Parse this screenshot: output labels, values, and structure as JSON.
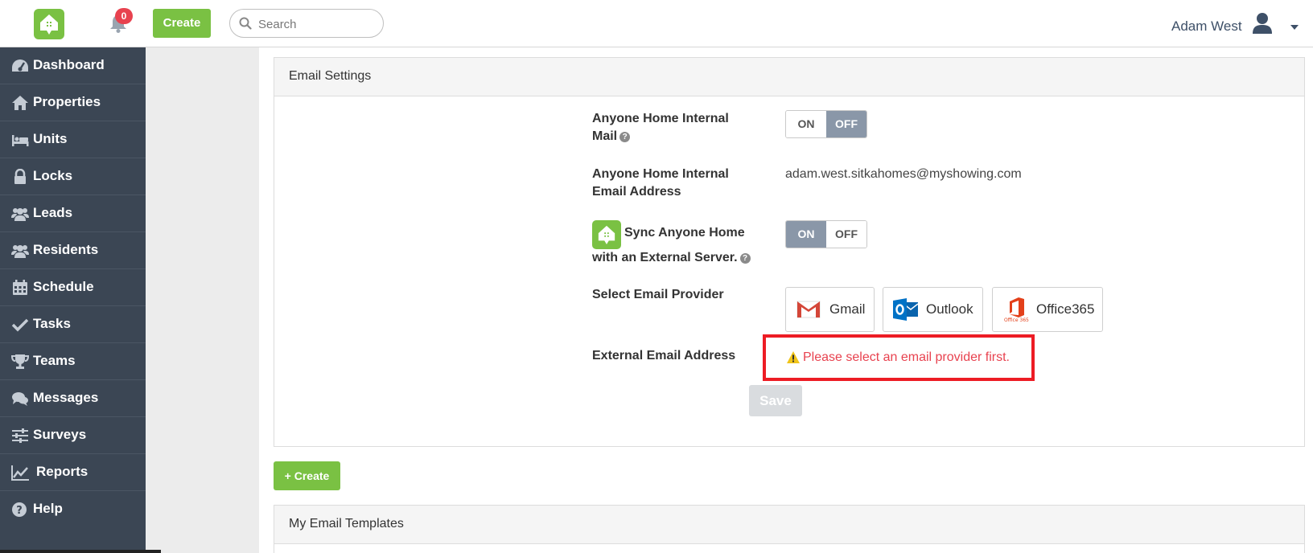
{
  "header": {
    "notification_count": "0",
    "create_label": "Create",
    "search_placeholder": "Search",
    "user_name": "Adam West",
    "brand_color": "#7ac143"
  },
  "sidebar": {
    "items": [
      {
        "label": "Dashboard",
        "icon": "dashboard-icon"
      },
      {
        "label": "Properties",
        "icon": "home-icon"
      },
      {
        "label": "Units",
        "icon": "bed-icon"
      },
      {
        "label": "Locks",
        "icon": "lock-icon"
      },
      {
        "label": "Leads",
        "icon": "users-icon"
      },
      {
        "label": "Residents",
        "icon": "users-icon"
      },
      {
        "label": "Schedule",
        "icon": "calendar-icon"
      },
      {
        "label": "Tasks",
        "icon": "check-icon"
      },
      {
        "label": "Teams",
        "icon": "trophy-icon"
      },
      {
        "label": "Messages",
        "icon": "comments-icon"
      },
      {
        "label": "Surveys",
        "icon": "sliders-icon"
      },
      {
        "label": "Reports",
        "icon": "line-chart-icon"
      },
      {
        "label": "Help",
        "icon": "question-circle-icon"
      }
    ]
  },
  "email_settings": {
    "title": "Email Settings",
    "internal_mail": {
      "label_line1": "Anyone Home Internal",
      "label_line2": "Mail",
      "on_label": "ON",
      "off_label": "OFF",
      "state": "OFF"
    },
    "internal_address": {
      "label_line1": "Anyone Home Internal",
      "label_line2": "Email Address",
      "value": "adam.west.sitkahomes@myshowing.com"
    },
    "sync": {
      "label_line1": "Sync Anyone Home",
      "label_line2": "with an External Server.",
      "on_label": "ON",
      "off_label": "OFF",
      "state": "ON"
    },
    "provider": {
      "label": "Select Email Provider",
      "options": [
        "Gmail",
        "Outlook",
        "Office365"
      ]
    },
    "external_address": {
      "label": "External Email Address",
      "error": "Please select an email provider first."
    },
    "save_label": "Save"
  },
  "create_label": "+ Create",
  "templates": {
    "title": "My Email Templates"
  }
}
